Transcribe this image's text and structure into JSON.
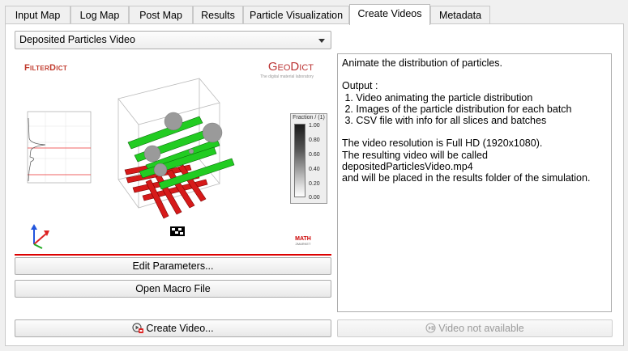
{
  "tabs": [
    {
      "label": "Input Map"
    },
    {
      "label": "Log Map"
    },
    {
      "label": "Post Map"
    },
    {
      "label": "Results"
    },
    {
      "label": "Particle Visualization"
    },
    {
      "label": "Create Videos"
    },
    {
      "label": "Metadata"
    }
  ],
  "active_tab": "Create Videos",
  "video_type": {
    "selected": "Deposited Particles Video"
  },
  "preview": {
    "logo_left": "FilterDict",
    "logo_right": "GeoDict",
    "logo_right_sub": "The digital material laboratory",
    "legend_title": "Fraction / (1)",
    "legend_ticks": [
      "1.00",
      "0.80",
      "0.60",
      "0.40",
      "0.20",
      "0.00"
    ],
    "math_logo": "MATH",
    "math_logo_sub": "2MARKET"
  },
  "buttons": {
    "edit_parameters": "Edit Parameters...",
    "open_macro": "Open Macro File",
    "create_video": "Create Video...",
    "video_not_available": "Video not available"
  },
  "description": {
    "lines": [
      "Animate the distribution of particles.",
      "",
      "Output :",
      " 1. Video animating the particle distribution",
      " 2. Images of the particle distribution for each batch",
      " 3. CSV file with info for all slices and batches",
      "",
      "The video resolution is Full HD (1920x1080).",
      "The resulting video will be called",
      "depositedParticlesVideo.mp4",
      "and will be placed in the results folder of the simulation."
    ]
  }
}
